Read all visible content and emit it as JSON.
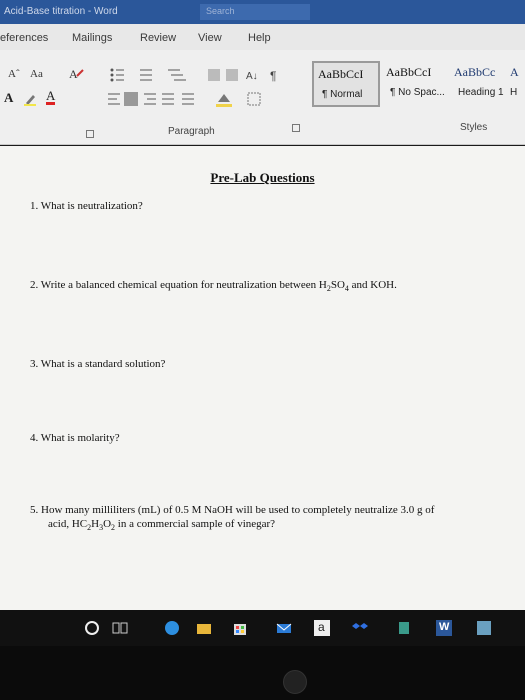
{
  "window": {
    "title": "Acid-Base titration - Word",
    "search_label": "Search"
  },
  "tabs": [
    "eferences",
    "Mailings",
    "Review",
    "View",
    "Help"
  ],
  "ribbon": {
    "font_controls": {
      "grow_font": "Aˆ",
      "change_case": "Aa",
      "text_effects": "A",
      "font_color": "A"
    },
    "paragraph_label": "Paragraph",
    "styles_label": "Styles",
    "styles": [
      {
        "sample": "AaBbCcI",
        "name": "¶ Normal"
      },
      {
        "sample": "AaBbCcI",
        "name": "¶ No Spac..."
      },
      {
        "sample": "AaBbCc",
        "name": "Heading 1"
      },
      {
        "sample": "A",
        "name": "H"
      }
    ]
  },
  "document": {
    "title": "Pre-Lab Questions",
    "questions": [
      "1. What is neutralization?",
      "2. Write a balanced chemical equation for neutralization between",
      "3. What is a standard solution?",
      "4. What is molarity?",
      "5. How many milliliters (mL) of 0.5 M NaOH will be used to completely neutralize 3.0 g of"
    ],
    "q2_formula_a": "H",
    "q2_formula_a_sub": "2",
    "q2_formula_b": "SO",
    "q2_formula_b_sub": "4",
    "q2_tail": "and KOH.",
    "q5_line2_a": "acid, HC",
    "q5_sub1": "2",
    "q5_mid1": "H",
    "q5_sub2": "3",
    "q5_mid2": "O",
    "q5_sub3": "2",
    "q5_line2_b": "in a commercial sample of vinegar?"
  },
  "taskbar": {
    "icons": [
      "search-circle-icon",
      "task-view-icon",
      "edge-icon",
      "file-explorer-icon",
      "store-icon",
      "mail-icon",
      "amazon-icon",
      "dropbox-icon",
      "other-icon",
      "word-icon",
      "app-icon"
    ],
    "amazon_letter": "a",
    "word_letter": "W"
  },
  "colors": {
    "titlebar": "#2b579a",
    "ribbon": "#efefef",
    "document": "#f4f4f2",
    "taskbar": "#111111"
  }
}
